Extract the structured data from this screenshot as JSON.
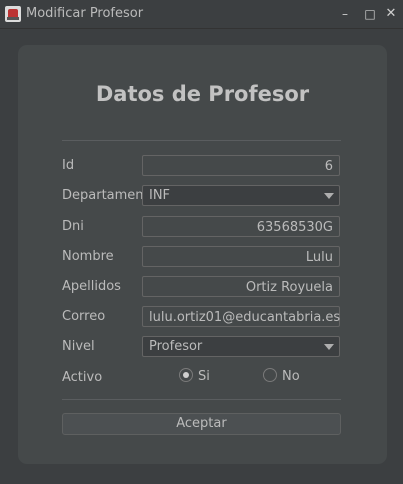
{
  "window": {
    "title": "Modificar Profesor",
    "controls": {
      "minimize": "–",
      "maximize": "□",
      "close": "✕"
    }
  },
  "form": {
    "heading": "Datos de Profesor",
    "fields": {
      "id": {
        "label": "Id",
        "value": "6"
      },
      "departamento": {
        "label": "Departamento",
        "value": "INF"
      },
      "dni": {
        "label": "Dni",
        "value": "63568530G"
      },
      "nombre": {
        "label": "Nombre",
        "value": "Lulu"
      },
      "apellidos": {
        "label": "Apellidos",
        "value": "Ortiz Royuela"
      },
      "correo": {
        "label": "Correo",
        "value": "lulu.ortiz01@educantabria.es"
      },
      "nivel": {
        "label": "Nivel",
        "value": "Profesor"
      },
      "activo": {
        "label": "Activo",
        "options": [
          {
            "label": "Si",
            "selected": true
          },
          {
            "label": "No",
            "selected": false
          }
        ]
      }
    },
    "submit_label": "Aceptar"
  },
  "colors": {
    "background": "#3c3f41",
    "panel": "#45494a",
    "text": "#bbbbbb",
    "border": "#646464"
  }
}
